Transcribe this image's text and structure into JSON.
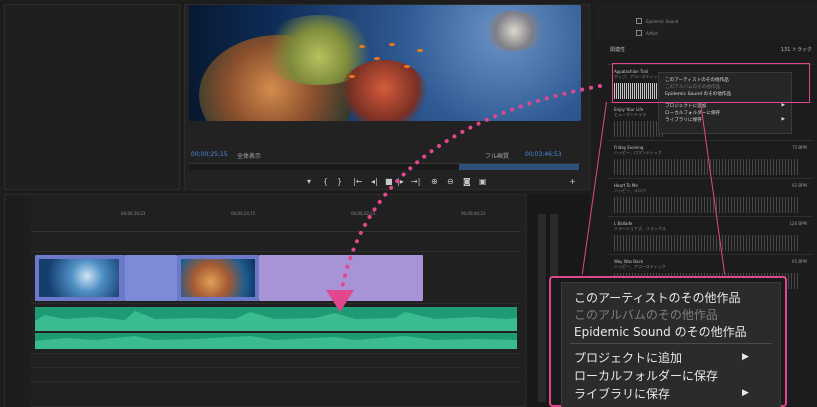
{
  "monitor": {
    "timecode_left": "00;00;25;15",
    "fit_label": "全体表示",
    "full_label": "フル画質",
    "timecode_right": "00;03;46;53",
    "transport_icons": [
      "marker-icon",
      "in-point-icon",
      "out-point-icon",
      "go-to-in-icon",
      "step-back-icon",
      "stop-icon",
      "step-forward-icon",
      "go-to-out-icon",
      "insert-icon",
      "overwrite-icon",
      "camera-icon",
      "export-frame-icon",
      "add-icon"
    ]
  },
  "music_panel": {
    "checkboxes": [
      "Epidemic Sound",
      "Artlist"
    ],
    "sort_label": "関連性",
    "count_label": "131 トラック",
    "tracks": [
      {
        "title": "Appalachian Trail",
        "meta": "ポップ、アコースティック",
        "bpm": ""
      },
      {
        "title": "Enjoy Your Life",
        "meta": "ヒューマンドラマ",
        "bpm": ""
      },
      {
        "title": "Friday Evening",
        "meta": "ハッピー、ロマンティック",
        "bpm": "75 BPM"
      },
      {
        "title": "Heart To Me",
        "meta": "ハッピー、メロウ",
        "bpm": "92 BPM"
      },
      {
        "title": "L Ballade",
        "meta": "ミラーショアズ、リラックス",
        "bpm": "120 BPM"
      },
      {
        "title": "Way Was Back",
        "meta": "ハッピー、アコースティック",
        "bpm": "95 BPM"
      }
    ],
    "small_menu": {
      "item1": "このアーティストのその他作品",
      "item2": "このアルバムのその他作品",
      "item3": "Epidemic Sound のその他作品",
      "item4": "プロジェクトに追加",
      "item5": "ローカルフォルダーに保存",
      "item6": "ライブラリに保存"
    }
  },
  "timeline": {
    "ruler": [
      "00;00;16;23",
      "00;00;24;15",
      "00;00;32;23",
      "00;00;40;23"
    ]
  },
  "context_menu": {
    "more_artist": "このアーティストのその他作品",
    "more_album": "このアルバムのその他作品",
    "more_epidemic": "Epidemic Sound のその他作品",
    "add_to_project": "プロジェクトに追加",
    "save_local": "ローカルフォルダーに保存",
    "save_library": "ライブラリに保存"
  },
  "colors": {
    "accent_pink": "#e0478f",
    "audio_green": "#1e9a74",
    "video_purple": "#6b79c8"
  }
}
